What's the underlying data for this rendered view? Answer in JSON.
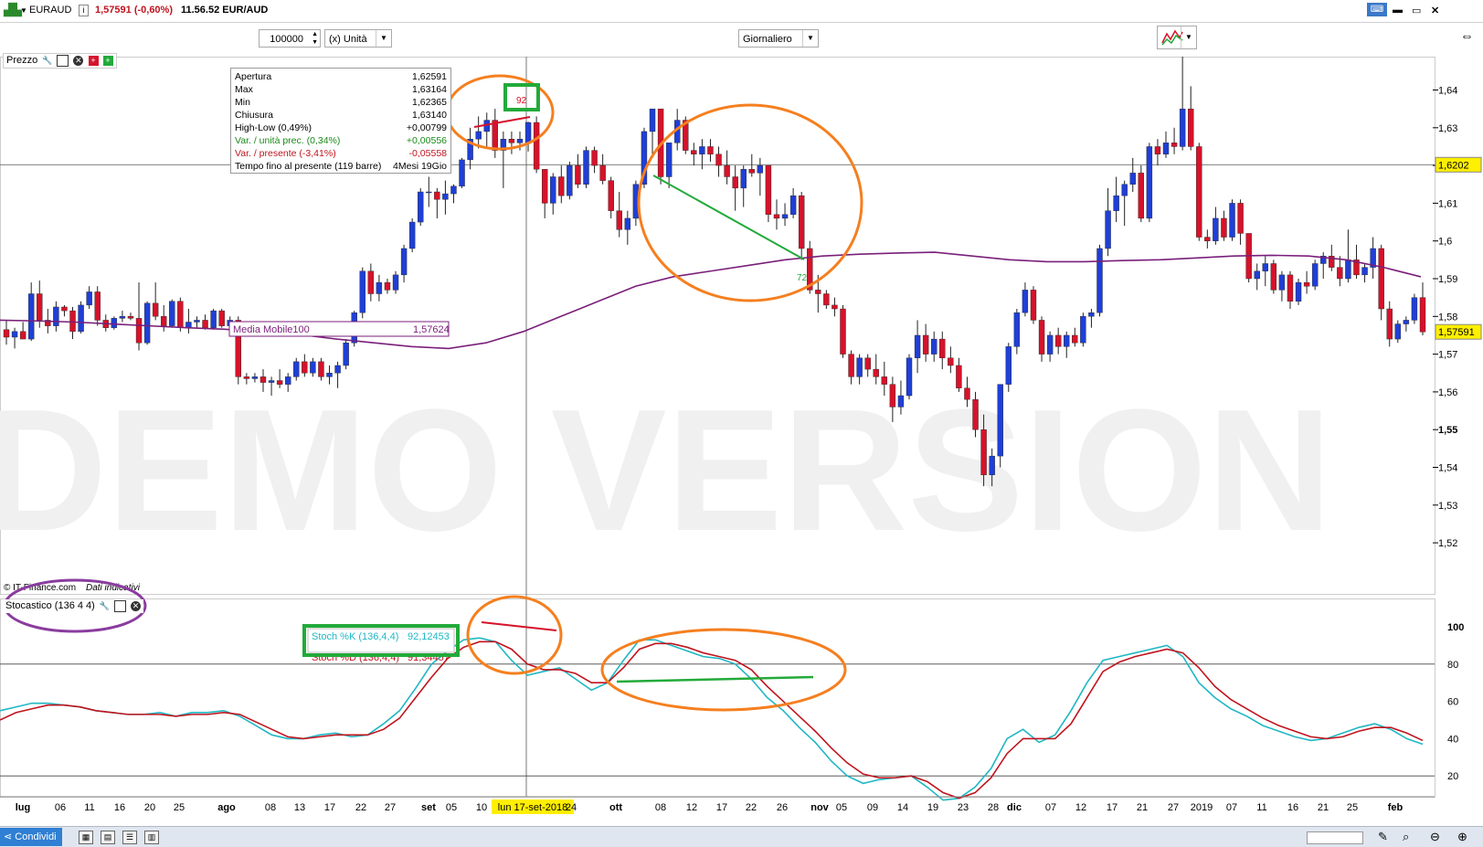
{
  "titlebar": {
    "symbol": "EURAUD",
    "info_icon": "i",
    "last": "1,57591 (-0,60%)",
    "time_pair": "11.56.52 EUR/AUD"
  },
  "toolbar": {
    "quantity": "100000",
    "unit": "(x) Unità",
    "period": "Giornaliero"
  },
  "price_panel": {
    "label": "Prezzo",
    "copyright": "© IT-Finance.com",
    "copyright_note": "Dati indicativi",
    "crosshair_value": "1,6202",
    "last_value": "1,57591",
    "watermark": "DEMO VERSION",
    "y_ticks": [
      "1,64",
      "1,63",
      "1,62",
      "1,61",
      "1,6",
      "1,59",
      "1,58",
      "1,57",
      "1,56",
      "1,55",
      "1,54",
      "1,53",
      "1,52"
    ],
    "ma_label": "Media Mobile100",
    "ma_value": "1,57624",
    "annot_top": "92",
    "annot_mid": "72"
  },
  "info_box": {
    "rows": [
      {
        "label": "Apertura",
        "value": "1,62591",
        "color": "#000000"
      },
      {
        "label": "Max",
        "value": "1,63164",
        "color": "#000000"
      },
      {
        "label": "Min",
        "value": "1,62365",
        "color": "#000000"
      },
      {
        "label": "Chiusura",
        "value": "1,63140",
        "color": "#000000"
      },
      {
        "label": "High-Low (0,49%)",
        "value": "+0,00799",
        "color": "#000000"
      },
      {
        "label": "Var. / unità prec. (0,34%)",
        "value": "+0,00556",
        "color": "#1a8a1a"
      },
      {
        "label": "Var. / presente (-3,41%)",
        "value": "-0,05558",
        "color": "#c0141e"
      },
      {
        "label": "Tempo fino al presente (119 barre)",
        "value": "4Mesi 19Gio",
        "color": "#000000"
      }
    ]
  },
  "stoch_panel": {
    "label": "Stocastico (136 4 4)",
    "k_label": "Stoch %K (136,4,4)",
    "k_value": "92,12453",
    "d_label": "Stoch %D (136,4,4)",
    "d_value": "91,34457",
    "y_ticks": [
      "100",
      "80",
      "60",
      "40",
      "20"
    ]
  },
  "x_axis": {
    "labels": [
      "lug",
      "06",
      "11",
      "16",
      "20",
      "25",
      "ago",
      "08",
      "13",
      "17",
      "22",
      "27",
      "set",
      "05",
      "10",
      "lun 17-set-2018",
      "24",
      "ott",
      "08",
      "12",
      "17",
      "22",
      "26",
      "nov",
      "05",
      "09",
      "14",
      "19",
      "23",
      "28",
      "dic",
      "07",
      "12",
      "17",
      "21",
      "27",
      "2019",
      "07",
      "11",
      "16",
      "21",
      "25",
      "feb"
    ]
  },
  "statusbar": {
    "share": "Condividi"
  },
  "colors": {
    "bull": "#1f3fd6",
    "bear": "#d6122a",
    "ma": "#7a1f7a",
    "stoch_k": "#1fb7c4",
    "stoch_d": "#c0141e",
    "annot_orange": "#f57f1f",
    "annot_green": "#22aa3a",
    "annot_purple": "#8a3c9e",
    "price_tag": "#ffef00"
  },
  "chart_data": {
    "type": "candlestick",
    "candles": [
      [
        1.5765,
        1.579,
        1.5725,
        1.5745
      ],
      [
        1.5745,
        1.577,
        1.5715,
        1.576
      ],
      [
        1.576,
        1.5785,
        1.5745,
        1.574
      ],
      [
        1.574,
        1.589,
        1.5735,
        1.586
      ],
      [
        1.586,
        1.5895,
        1.577,
        1.579
      ],
      [
        1.579,
        1.582,
        1.5755,
        1.5775
      ],
      [
        1.5775,
        1.584,
        1.576,
        1.5825
      ],
      [
        1.5825,
        1.583,
        1.58,
        1.5815
      ],
      [
        1.5815,
        1.5825,
        1.574,
        1.576
      ],
      [
        1.576,
        1.584,
        1.5755,
        1.583
      ],
      [
        1.583,
        1.588,
        1.582,
        1.5865
      ],
      [
        1.5865,
        1.588,
        1.5775,
        1.579
      ],
      [
        1.579,
        1.5805,
        1.576,
        1.577
      ],
      [
        1.577,
        1.58,
        1.5765,
        1.5795
      ],
      [
        1.5795,
        1.5815,
        1.5785,
        1.58
      ],
      [
        1.58,
        1.581,
        1.579,
        1.5795
      ],
      [
        1.5795,
        1.589,
        1.571,
        1.573
      ],
      [
        1.573,
        1.584,
        1.5725,
        1.5835
      ],
      [
        1.5835,
        1.589,
        1.579,
        1.58
      ],
      [
        1.58,
        1.583,
        1.576,
        1.5775
      ],
      [
        1.5775,
        1.5845,
        1.577,
        1.584
      ],
      [
        1.584,
        1.585,
        1.576,
        1.577
      ],
      [
        1.577,
        1.582,
        1.5755,
        1.5785
      ],
      [
        1.5785,
        1.58,
        1.577,
        1.579
      ],
      [
        1.579,
        1.5805,
        1.5765,
        1.577
      ],
      [
        1.577,
        1.582,
        1.5765,
        1.5815
      ],
      [
        1.5815,
        1.582,
        1.577,
        1.5775
      ],
      [
        1.5775,
        1.58,
        1.577,
        1.579
      ],
      [
        1.579,
        1.58,
        1.562,
        1.564
      ],
      [
        1.564,
        1.565,
        1.562,
        1.5635
      ],
      [
        1.5635,
        1.565,
        1.5625,
        1.564
      ],
      [
        1.564,
        1.566,
        1.56,
        1.5625
      ],
      [
        1.5625,
        1.564,
        1.559,
        1.563
      ],
      [
        1.563,
        1.566,
        1.561,
        1.562
      ],
      [
        1.562,
        1.565,
        1.56,
        1.564
      ],
      [
        1.564,
        1.569,
        1.563,
        1.568
      ],
      [
        1.568,
        1.57,
        1.564,
        1.565
      ],
      [
        1.565,
        1.569,
        1.564,
        1.568
      ],
      [
        1.568,
        1.569,
        1.563,
        1.564
      ],
      [
        1.564,
        1.567,
        1.562,
        1.565
      ],
      [
        1.565,
        1.568,
        1.561,
        1.567
      ],
      [
        1.567,
        1.574,
        1.566,
        1.573
      ],
      [
        1.573,
        1.5815,
        1.572,
        1.581
      ],
      [
        1.581,
        1.593,
        1.5795,
        1.592
      ],
      [
        1.592,
        1.594,
        1.584,
        1.586
      ],
      [
        1.586,
        1.591,
        1.584,
        1.589
      ],
      [
        1.589,
        1.59,
        1.586,
        1.587
      ],
      [
        1.587,
        1.592,
        1.586,
        1.591
      ],
      [
        1.591,
        1.599,
        1.589,
        1.598
      ],
      [
        1.598,
        1.606,
        1.597,
        1.605
      ],
      [
        1.605,
        1.614,
        1.604,
        1.613
      ],
      [
        1.613,
        1.617,
        1.609,
        1.613
      ],
      [
        1.613,
        1.614,
        1.606,
        1.611
      ],
      [
        1.611,
        1.616,
        1.607,
        1.6125
      ],
      [
        1.6125,
        1.615,
        1.61,
        1.6145
      ],
      [
        1.6145,
        1.622,
        1.614,
        1.6215
      ],
      [
        1.6215,
        1.63,
        1.619,
        1.627
      ],
      [
        1.627,
        1.633,
        1.6245,
        1.629
      ],
      [
        1.629,
        1.634,
        1.625,
        1.632
      ],
      [
        1.632,
        1.635,
        1.622,
        1.624
      ],
      [
        1.624,
        1.629,
        1.614,
        1.627
      ],
      [
        1.627,
        1.629,
        1.623,
        1.626
      ],
      [
        1.626,
        1.629,
        1.624,
        1.627
      ],
      [
        1.6259,
        1.6316,
        1.6237,
        1.6314
      ],
      [
        1.6314,
        1.633,
        1.618,
        1.619
      ],
      [
        1.619,
        1.619,
        1.606,
        1.61
      ],
      [
        1.61,
        1.618,
        1.607,
        1.617
      ],
      [
        1.617,
        1.62,
        1.61,
        1.612
      ],
      [
        1.612,
        1.621,
        1.611,
        1.62
      ],
      [
        1.62,
        1.623,
        1.614,
        1.615
      ],
      [
        1.615,
        1.625,
        1.614,
        1.624
      ],
      [
        1.624,
        1.625,
        1.618,
        1.62
      ],
      [
        1.62,
        1.623,
        1.615,
        1.616
      ],
      [
        1.616,
        1.617,
        1.606,
        1.608
      ],
      [
        1.608,
        1.613,
        1.601,
        1.603
      ],
      [
        1.603,
        1.608,
        1.599,
        1.606
      ],
      [
        1.606,
        1.616,
        1.604,
        1.615
      ],
      [
        1.615,
        1.63,
        1.614,
        1.629
      ],
      [
        1.629,
        1.635,
        1.623,
        1.635
      ],
      [
        1.635,
        1.635,
        1.615,
        1.617
      ],
      [
        1.617,
        1.626,
        1.614,
        1.626
      ],
      [
        1.626,
        1.635,
        1.624,
        1.632
      ],
      [
        1.632,
        1.633,
        1.623,
        1.624
      ],
      [
        1.624,
        1.626,
        1.62,
        1.623
      ],
      [
        1.623,
        1.627,
        1.619,
        1.625
      ],
      [
        1.625,
        1.627,
        1.621,
        1.623
      ],
      [
        1.623,
        1.625,
        1.617,
        1.62
      ],
      [
        1.62,
        1.624,
        1.615,
        1.617
      ],
      [
        1.617,
        1.62,
        1.608,
        1.614
      ],
      [
        1.614,
        1.62,
        1.609,
        1.619
      ],
      [
        1.619,
        1.623,
        1.617,
        1.618
      ],
      [
        1.618,
        1.622,
        1.612,
        1.62
      ],
      [
        1.62,
        1.62,
        1.605,
        1.607
      ],
      [
        1.607,
        1.611,
        1.603,
        1.606
      ],
      [
        1.606,
        1.61,
        1.604,
        1.607
      ],
      [
        1.607,
        1.614,
        1.606,
        1.612
      ],
      [
        1.612,
        1.613,
        1.595,
        1.598
      ],
      [
        1.598,
        1.6,
        1.586,
        1.587
      ],
      [
        1.587,
        1.591,
        1.581,
        1.586
      ],
      [
        1.586,
        1.587,
        1.582,
        1.583
      ],
      [
        1.583,
        1.585,
        1.58,
        1.582
      ],
      [
        1.582,
        1.583,
        1.569,
        1.57
      ],
      [
        1.57,
        1.571,
        1.562,
        1.564
      ],
      [
        1.564,
        1.57,
        1.562,
        1.569
      ],
      [
        1.569,
        1.57,
        1.564,
        1.566
      ],
      [
        1.566,
        1.57,
        1.562,
        1.564
      ],
      [
        1.564,
        1.568,
        1.559,
        1.562
      ],
      [
        1.562,
        1.564,
        1.552,
        1.556
      ],
      [
        1.556,
        1.563,
        1.554,
        1.559
      ],
      [
        1.559,
        1.57,
        1.558,
        1.569
      ],
      [
        1.569,
        1.579,
        1.565,
        1.575
      ],
      [
        1.575,
        1.578,
        1.568,
        1.57
      ],
      [
        1.57,
        1.576,
        1.568,
        1.574
      ],
      [
        1.574,
        1.576,
        1.566,
        1.569
      ],
      [
        1.569,
        1.572,
        1.565,
        1.567
      ],
      [
        1.567,
        1.569,
        1.56,
        1.561
      ],
      [
        1.561,
        1.564,
        1.556,
        1.558
      ],
      [
        1.558,
        1.56,
        1.548,
        1.55
      ],
      [
        1.55,
        1.554,
        1.535,
        1.538
      ],
      [
        1.538,
        1.545,
        1.535,
        1.543
      ],
      [
        1.543,
        1.562,
        1.54,
        1.562
      ],
      [
        1.562,
        1.573,
        1.56,
        1.572
      ],
      [
        1.572,
        1.582,
        1.57,
        1.581
      ],
      [
        1.581,
        1.589,
        1.58,
        1.587
      ],
      [
        1.587,
        1.588,
        1.578,
        1.579
      ],
      [
        1.579,
        1.58,
        1.568,
        1.57
      ],
      [
        1.57,
        1.576,
        1.568,
        1.575
      ],
      [
        1.575,
        1.577,
        1.57,
        1.572
      ],
      [
        1.572,
        1.576,
        1.569,
        1.575
      ],
      [
        1.575,
        1.577,
        1.572,
        1.573
      ],
      [
        1.573,
        1.581,
        1.572,
        1.58
      ],
      [
        1.58,
        1.582,
        1.577,
        1.581
      ],
      [
        1.581,
        1.599,
        1.58,
        1.598
      ],
      [
        1.598,
        1.614,
        1.596,
        1.608
      ],
      [
        1.608,
        1.617,
        1.605,
        1.612
      ],
      [
        1.612,
        1.616,
        1.604,
        1.615
      ],
      [
        1.615,
        1.622,
        1.613,
        1.618
      ],
      [
        1.618,
        1.62,
        1.605,
        1.606
      ],
      [
        1.606,
        1.626,
        1.605,
        1.625
      ],
      [
        1.625,
        1.627,
        1.62,
        1.623
      ],
      [
        1.623,
        1.629,
        1.622,
        1.626
      ],
      [
        1.626,
        1.63,
        1.623,
        1.625
      ],
      [
        1.625,
        1.649,
        1.624,
        1.635
      ],
      [
        1.635,
        1.641,
        1.624,
        1.625
      ],
      [
        1.625,
        1.626,
        1.6,
        1.601
      ],
      [
        1.601,
        1.603,
        1.598,
        1.6
      ],
      [
        1.6,
        1.609,
        1.599,
        1.606
      ],
      [
        1.606,
        1.608,
        1.6,
        1.601
      ],
      [
        1.601,
        1.611,
        1.6,
        1.61
      ],
      [
        1.61,
        1.611,
        1.599,
        1.602
      ],
      [
        1.602,
        1.602,
        1.589,
        1.59
      ],
      [
        1.59,
        1.594,
        1.587,
        1.592
      ],
      [
        1.592,
        1.596,
        1.588,
        1.594
      ],
      [
        1.594,
        1.595,
        1.586,
        1.587
      ],
      [
        1.587,
        1.592,
        1.584,
        1.591
      ],
      [
        1.591,
        1.592,
        1.582,
        1.584
      ],
      [
        1.584,
        1.59,
        1.583,
        1.589
      ],
      [
        1.589,
        1.592,
        1.586,
        1.588
      ],
      [
        1.588,
        1.595,
        1.587,
        1.594
      ],
      [
        1.594,
        1.597,
        1.59,
        1.596
      ],
      [
        1.596,
        1.599,
        1.592,
        1.593
      ],
      [
        1.593,
        1.596,
        1.588,
        1.59
      ],
      [
        1.59,
        1.603,
        1.589,
        1.595
      ],
      [
        1.595,
        1.599,
        1.59,
        1.591
      ],
      [
        1.591,
        1.594,
        1.589,
        1.593
      ],
      [
        1.593,
        1.601,
        1.59,
        1.598
      ],
      [
        1.598,
        1.599,
        1.579,
        1.582
      ],
      [
        1.582,
        1.584,
        1.572,
        1.574
      ],
      [
        1.574,
        1.579,
        1.573,
        1.578
      ],
      [
        1.578,
        1.58,
        1.576,
        1.579
      ],
      [
        1.579,
        1.586,
        1.578,
        1.585
      ],
      [
        1.585,
        1.589,
        1.575,
        1.5759
      ]
    ],
    "ma_y": [
      1.579,
      1.5788,
      1.5785,
      1.578,
      1.5775,
      1.577,
      1.5766,
      1.576,
      1.5752,
      1.574,
      1.573,
      1.572,
      1.5715,
      1.573,
      1.576,
      1.58,
      1.584,
      1.588,
      1.5905,
      1.592,
      1.5935,
      1.595,
      1.596,
      1.5965,
      1.5968,
      1.597,
      1.596,
      1.595,
      1.5945,
      1.5945,
      1.5948,
      1.595,
      1.5955,
      1.596,
      1.5962,
      1.596,
      1.595,
      1.593,
      1.5905
    ],
    "stoch_k": [
      55,
      57,
      59,
      59,
      58,
      57,
      55,
      54,
      53,
      53,
      54,
      52,
      54,
      54,
      55,
      52,
      47,
      42,
      40,
      40,
      42,
      43,
      41,
      42,
      48,
      55,
      67,
      80,
      87,
      93,
      94,
      92,
      82,
      74,
      76,
      78,
      72,
      66,
      70,
      82,
      93,
      93,
      90,
      87,
      84,
      83,
      80,
      72,
      62,
      55,
      46,
      38,
      28,
      20,
      16,
      18,
      19,
      20,
      14,
      7,
      8,
      14,
      24,
      40,
      45,
      38,
      42,
      55,
      70,
      82,
      84,
      86,
      88,
      90,
      84,
      70,
      62,
      56,
      52,
      47,
      44,
      41,
      39,
      40,
      43,
      46,
      48,
      45,
      40,
      37
    ],
    "stoch_d": [
      50,
      54,
      56,
      58,
      58,
      57,
      55,
      54,
      53,
      53,
      53,
      52,
      53,
      53,
      54,
      53,
      49,
      45,
      41,
      40,
      41,
      42,
      42,
      42,
      45,
      51,
      62,
      73,
      83,
      89,
      92,
      92,
      88,
      80,
      77,
      77,
      75,
      70,
      70,
      78,
      88,
      91,
      91,
      89,
      86,
      84,
      82,
      77,
      68,
      60,
      52,
      44,
      35,
      27,
      21,
      19,
      19,
      20,
      17,
      11,
      8,
      11,
      19,
      32,
      40,
      40,
      40,
      48,
      62,
      76,
      81,
      84,
      86,
      88,
      86,
      78,
      68,
      61,
      56,
      51,
      47,
      44,
      41,
      40,
      41,
      44,
      46,
      46,
      43,
      39
    ]
  }
}
